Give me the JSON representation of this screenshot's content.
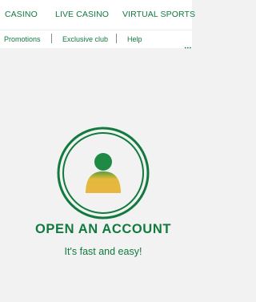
{
  "top_nav": {
    "tabs": [
      "CASINO",
      "LIVE CASINO",
      "VIRTUAL SPORTS"
    ]
  },
  "sub_nav": {
    "links": [
      "Promotions",
      "Exclusive club",
      "Help"
    ]
  },
  "account_cta": {
    "title": "OPEN AN ACCOUNT",
    "subtitle": "It's fast and easy!",
    "icon": "user-avatar-icon"
  },
  "colors": {
    "brand_green": "#127a3e",
    "avatar_head": "#1f8a45",
    "avatar_body_top": "#e4b93c",
    "avatar_body_bottom": "#5a9c3a",
    "background": "#f2f2f2"
  }
}
